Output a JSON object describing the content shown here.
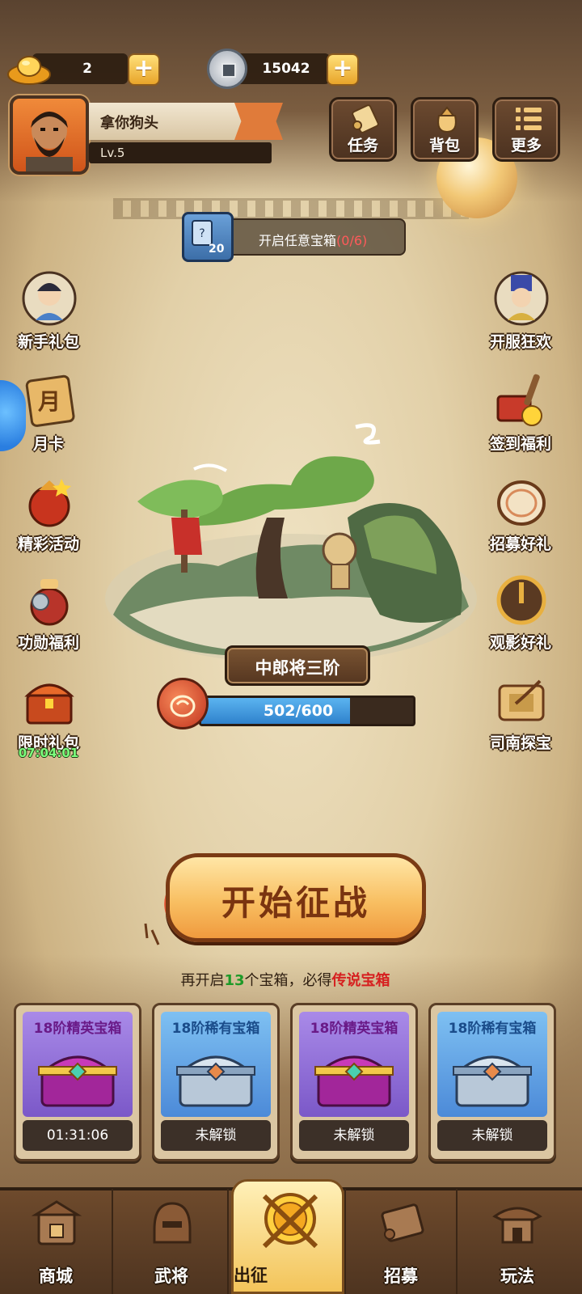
{
  "currency": {
    "ingot_amount": "2",
    "coin_amount": "15042",
    "ingot_icon": "gold-ingot-icon",
    "coin_icon": "copper-coin-icon",
    "add_icon": "plus-icon"
  },
  "player": {
    "name": "拿你狗头",
    "level": "Lv.5"
  },
  "top_menu": [
    {
      "label": "任务",
      "icon": "scroll-icon"
    },
    {
      "label": "背包",
      "icon": "bag-icon"
    },
    {
      "label": "更多",
      "icon": "list-icon"
    }
  ],
  "quest": {
    "card_count": "20",
    "text": "开启任意宝箱",
    "progress": "(0/6)"
  },
  "left_side": [
    {
      "label": "新手礼包",
      "icon": "hero-portrait-icon"
    },
    {
      "label": "月卡",
      "icon": "month-card-icon",
      "glyph": "月"
    },
    {
      "label": "精彩活动",
      "icon": "event-bag-icon"
    },
    {
      "label": "功勋福利",
      "icon": "coin-pouch-icon"
    },
    {
      "label": "限时礼包",
      "icon": "treasure-chest-icon"
    }
  ],
  "timer": "07:04:01",
  "right_side": [
    {
      "label": "开服狂欢",
      "icon": "official-portrait-icon"
    },
    {
      "label": "签到福利",
      "icon": "stamp-icon"
    },
    {
      "label": "招募好礼",
      "icon": "drum-icon"
    },
    {
      "label": "观影好礼",
      "icon": "film-icon"
    },
    {
      "label": "司南探宝",
      "icon": "compass-icon"
    }
  ],
  "stage": {
    "rank": "中郎将三阶",
    "exp_text": "502/600",
    "exp_current": 502,
    "exp_max": 600
  },
  "start_button": "开始征战",
  "hint": {
    "prefix": "再开启",
    "count": "13",
    "middle": "个宝箱，必得",
    "reward": "传说宝箱"
  },
  "chests": [
    {
      "title": "18阶精英宝箱",
      "status": "01:31:06",
      "variant": "purple"
    },
    {
      "title": "18阶稀有宝箱",
      "status": "未解锁",
      "variant": "blue"
    },
    {
      "title": "18阶精英宝箱",
      "status": "未解锁",
      "variant": "purple"
    },
    {
      "title": "18阶稀有宝箱",
      "status": "未解锁",
      "variant": "blue"
    }
  ],
  "nav": [
    {
      "label": "商城",
      "icon": "shop-icon"
    },
    {
      "label": "武将",
      "icon": "helmet-icon"
    },
    {
      "label": "出征",
      "icon": "battle-medal-icon",
      "active": true
    },
    {
      "label": "招募",
      "icon": "recruit-scroll-icon"
    },
    {
      "label": "玩法",
      "icon": "pavilion-icon"
    }
  ],
  "colors": {
    "exp_fill": "#2f82cc",
    "timer": "#7dff7d",
    "hint_count": "#1d9a28",
    "hint_reward": "#d62020",
    "quest_progress": "#ff5a5a"
  }
}
